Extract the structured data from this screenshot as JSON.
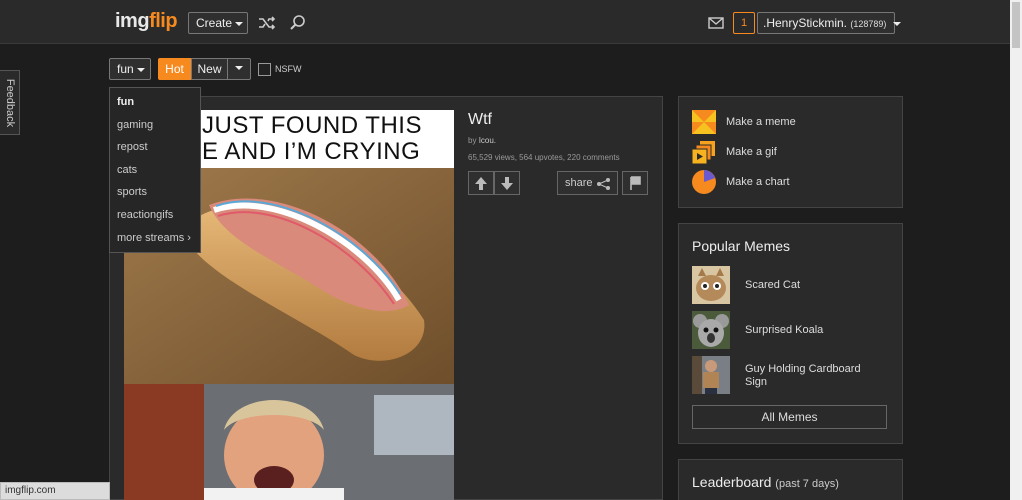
{
  "header": {
    "logo_main": "img",
    "logo_accent": "flip",
    "create_label": "Create",
    "notification_count": "1",
    "username": ".HenryStickmin.",
    "user_points": "(128789)"
  },
  "feedback_label": "Feedback",
  "filters": {
    "stream": "fun",
    "hot_label": "Hot",
    "new_label": "New",
    "nsfw_label": "NSFW"
  },
  "stream_menu": {
    "items": [
      "fun",
      "gaming",
      "repost",
      "cats",
      "sports",
      "reactiongifs",
      "more streams ›"
    ]
  },
  "post": {
    "caption_line1": "JUST FOUND THIS",
    "caption_line2": "E AND I’M CRYING",
    "title": "Wtf",
    "by_prefix": "by",
    "author": "Icou.",
    "stats": "65,529 views, 564 upvotes, 220 comments",
    "share_label": "share"
  },
  "make": {
    "meme": "Make a meme",
    "gif": "Make a gif",
    "chart": "Make a chart"
  },
  "popular": {
    "title": "Popular Memes",
    "items": [
      "Scared Cat",
      "Surprised Koala",
      "Guy Holding Cardboard Sign"
    ],
    "all_label": "All Memes"
  },
  "leaderboard": {
    "title": "Leaderboard",
    "subtitle": "(past 7 days)"
  },
  "status_url": "imgflip.com",
  "colors": {
    "accent": "#f68a1f",
    "background": "#1d1d1d",
    "panel": "#2a2a2a"
  }
}
